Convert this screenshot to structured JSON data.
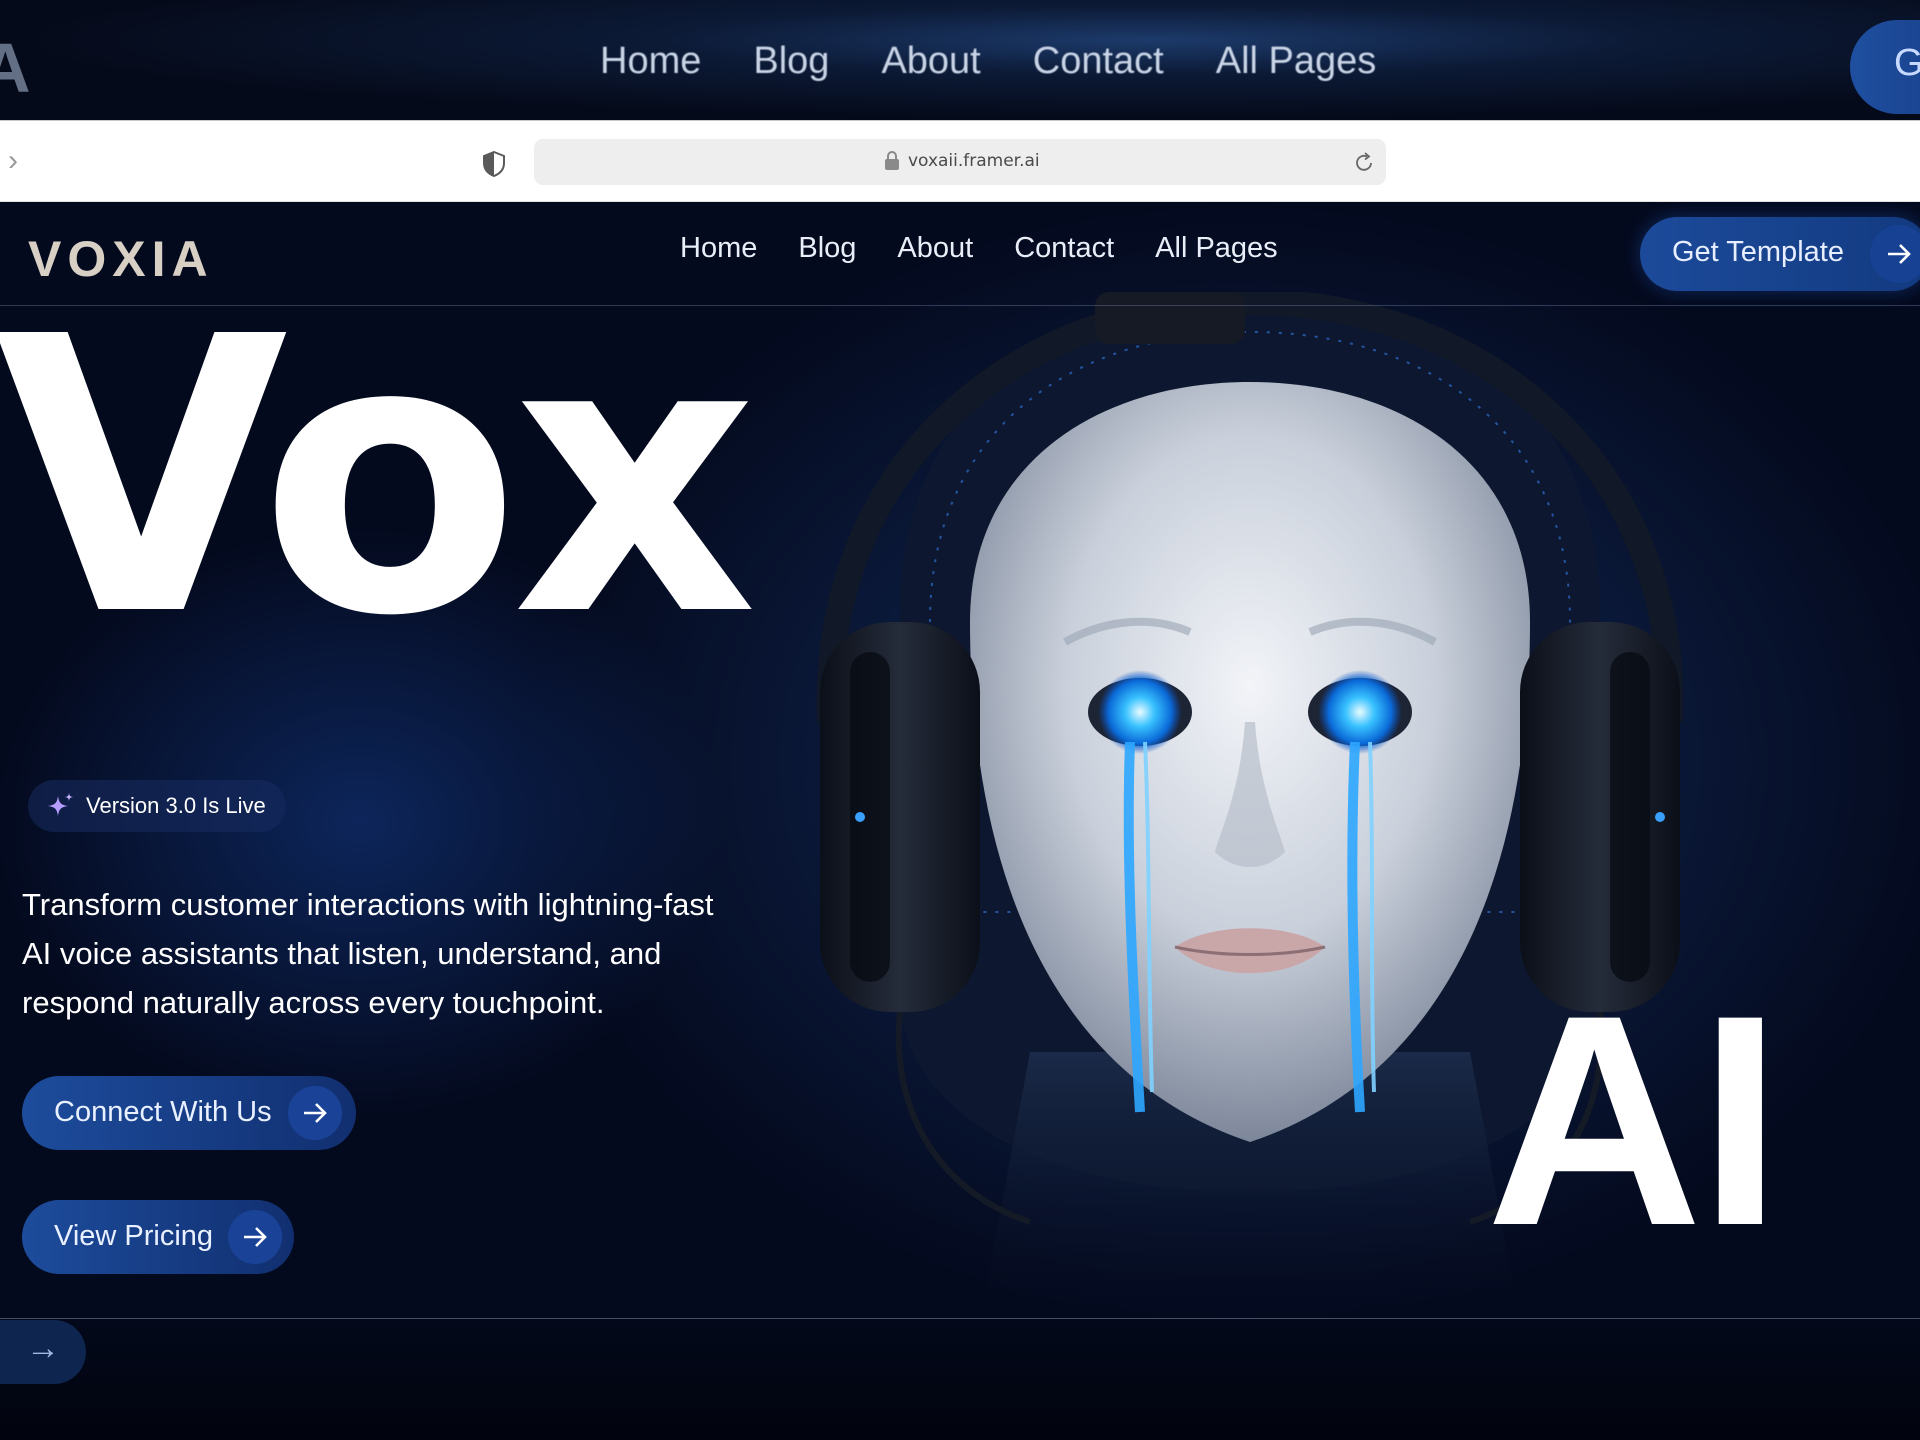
{
  "background": {
    "nav": [
      "Home",
      "Blog",
      "About",
      "Contact",
      "All Pages"
    ],
    "cta_fragment": "Ge"
  },
  "browser": {
    "url": "voxaii.framer.ai"
  },
  "site": {
    "logo": "VOXIA",
    "nav": [
      {
        "label": "Home"
      },
      {
        "label": "Blog"
      },
      {
        "label": "About"
      },
      {
        "label": "Contact"
      },
      {
        "label": "All Pages"
      }
    ],
    "cta_label": "Get Template",
    "hero_title_left": "Vox",
    "hero_title_right": "AI",
    "badge": "Version 3.0 Is Live",
    "description": "Transform customer interactions with lightning-fast AI voice assistants that listen, understand, and respond naturally across every touchpoint.",
    "primary_button": "Connect With Us",
    "secondary_button": "View Pricing"
  },
  "colors": {
    "accent": "#1d4c9c",
    "eye_glow": "#27b4ff",
    "background": "#061235"
  }
}
